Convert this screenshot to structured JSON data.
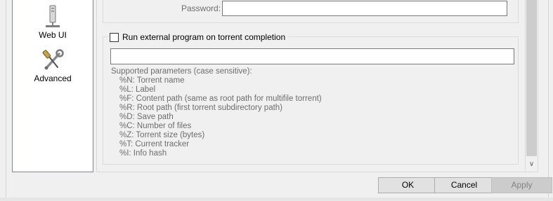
{
  "sidebar": {
    "items": [
      {
        "label": "Web UI",
        "icon": "web-ui-tower-icon"
      },
      {
        "label": "Advanced",
        "icon": "wrench-screwdriver-icon"
      }
    ]
  },
  "connection": {
    "password_label": "Password:",
    "password_value": ""
  },
  "run_external": {
    "checkbox_label": "Run external program on torrent completion",
    "checked": false,
    "command_value": "",
    "params_header": "Supported parameters (case sensitive):",
    "params": [
      "%N: Torrent name",
      "%L: Label",
      "%F: Content path (same as root path for multifile torrent)",
      "%R: Root path (first torrent subdirectory path)",
      "%D: Save path",
      "%C: Number of files",
      "%Z: Torrent size (bytes)",
      "%T: Current tracker",
      "%I: Info hash"
    ]
  },
  "buttons": {
    "ok": "OK",
    "cancel": "Cancel",
    "apply": "Apply"
  }
}
